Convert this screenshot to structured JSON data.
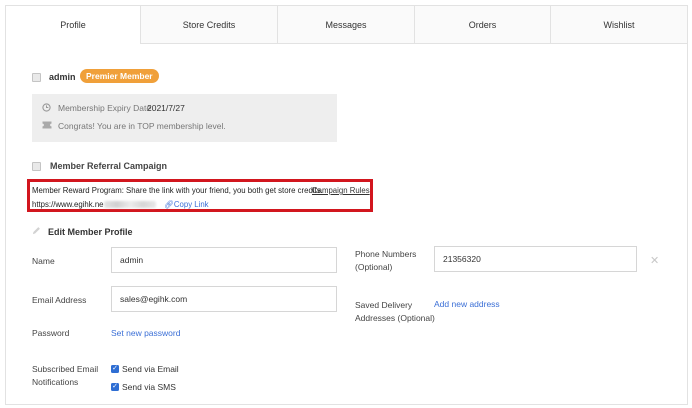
{
  "tabs": [
    {
      "label": "Profile"
    },
    {
      "label": "Store Credits"
    },
    {
      "label": "Messages"
    },
    {
      "label": "Orders"
    },
    {
      "label": "Wishlist"
    }
  ],
  "account": {
    "username": "admin",
    "member_badge": "Premier Member",
    "expiry_label": "Membership Expiry Date",
    "expiry_value": "2021/7/27",
    "congrats_text": "Congrats! You are in TOP membership level."
  },
  "referral": {
    "title": "Member Referral Campaign",
    "program_text": "Member Reward Program: Share the link with your friend, you both get store credits.",
    "rules_link": "Campaign Rules",
    "link_prefix": "https://www.egihk.ne",
    "copy_link": "Copy Link"
  },
  "edit_profile": {
    "title": "Edit Member Profile",
    "name_label": "Name",
    "name_value": "admin",
    "email_label": "Email Address",
    "email_value": "sales@egihk.com",
    "password_label": "Password",
    "password_link": "Set new password",
    "phone_label_line1": "Phone Numbers",
    "phone_label_line2": "(Optional)",
    "phone_value": "21356320",
    "delivery_label_line1": "Saved Delivery",
    "delivery_label_line2": "Addresses (Optional)",
    "add_address_link": "Add new address",
    "subscribed_label_line1": "Subscribed Email",
    "subscribed_label_line2": "Notifications",
    "send_email_label": "Send via Email",
    "send_sms_label": "Send via SMS"
  },
  "icons": {
    "clock": "clock-icon",
    "ticket": "ticket-icon",
    "pencil": "pencil-icon",
    "close": "close-icon",
    "link": "link-icon"
  },
  "colors": {
    "badge": "#f0a03a",
    "highlight_border": "#d2161e",
    "link": "#3b6fd6",
    "checkbox": "#2f6ed3"
  }
}
